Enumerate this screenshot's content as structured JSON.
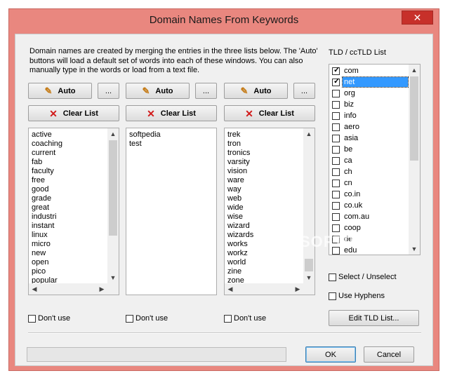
{
  "window": {
    "title": "Domain Names From Keywords",
    "close_glyph": "✕"
  },
  "description": "Domain names are created by merging the entries in the three lists below. The 'Auto' buttons will load a default set of words into each of these windows. You can also manually type in the words or load from a text file.",
  "tld_list_label": "TLD / ccTLD List",
  "columns": [
    {
      "auto_label": "Auto",
      "more_label": "...",
      "clear_label": "Clear List",
      "dont_use_label": "Don't use",
      "items": [
        "active",
        "coaching",
        "current",
        "fab",
        "faculty",
        "free",
        "good",
        "grade",
        "great",
        "industri",
        "instant",
        "linux",
        "micro",
        "new",
        "open",
        "pico",
        "popular"
      ]
    },
    {
      "auto_label": "Auto",
      "more_label": "...",
      "clear_label": "Clear List",
      "dont_use_label": "Don't use",
      "items": [
        "softpedia",
        "test"
      ]
    },
    {
      "auto_label": "Auto",
      "more_label": "...",
      "clear_label": "Clear List",
      "dont_use_label": "Don't use",
      "items": [
        "trek",
        "tron",
        "tronics",
        "varsity",
        "vision",
        "ware",
        "way",
        "web",
        "wide",
        "wise",
        "wizard",
        "wizards",
        "works",
        "workz",
        "world",
        "zine",
        "zone"
      ]
    }
  ],
  "tlds": [
    {
      "name": "com",
      "checked": true
    },
    {
      "name": "net",
      "checked": true,
      "selected": true
    },
    {
      "name": "org",
      "checked": false
    },
    {
      "name": "biz",
      "checked": false
    },
    {
      "name": "info",
      "checked": false
    },
    {
      "name": "aero",
      "checked": false
    },
    {
      "name": "asia",
      "checked": false
    },
    {
      "name": "be",
      "checked": false
    },
    {
      "name": "ca",
      "checked": false
    },
    {
      "name": "ch",
      "checked": false
    },
    {
      "name": "cn",
      "checked": false
    },
    {
      "name": "co.in",
      "checked": false
    },
    {
      "name": "co.uk",
      "checked": false
    },
    {
      "name": "com.au",
      "checked": false
    },
    {
      "name": "coop",
      "checked": false
    },
    {
      "name": "de",
      "checked": false
    },
    {
      "name": "edu",
      "checked": false
    }
  ],
  "select_unselect_label": "Select / Unselect",
  "use_hyphens_label": "Use Hyphens",
  "edit_tld_label": "Edit TLD List...",
  "ok_label": "OK",
  "cancel_label": "Cancel",
  "watermark": "SOFTPEDIA",
  "icons": {
    "auto": "pencil-icon",
    "clear": "red-x-icon"
  }
}
